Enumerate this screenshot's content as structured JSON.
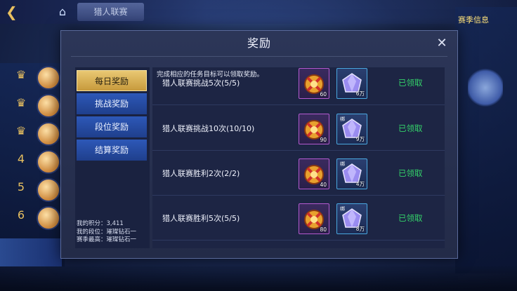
{
  "background": {
    "tab_label": "猎人联赛",
    "right_title": "赛季信息",
    "ranks": [
      "♛",
      "♛",
      "♛",
      "4",
      "5",
      "6"
    ]
  },
  "modal": {
    "title": "奖励",
    "close_icon": "close-icon",
    "hint": "完成相应的任务目标可以领取奖励。",
    "tabs": [
      {
        "label": "每日奖励",
        "active": true
      },
      {
        "label": "挑战奖励",
        "active": false
      },
      {
        "label": "段位奖励",
        "active": false
      },
      {
        "label": "结算奖励",
        "active": false
      }
    ],
    "stats": {
      "score": "我的积分：3,411",
      "rank": "我的段位：璀璨钻石一",
      "season_best": "赛季最高：璀璨钻石一"
    },
    "rows": [
      {
        "task": "猎人联赛挑战5次(5/5)",
        "reward1_qty": "60",
        "reward2_qty": "6万",
        "reward2_tag": "",
        "status": "已领取"
      },
      {
        "task": "猎人联赛挑战10次(10/10)",
        "reward1_qty": "90",
        "reward2_qty": "9万",
        "reward2_tag": "绑",
        "status": "已领取"
      },
      {
        "task": "猎人联赛胜利2次(2/2)",
        "reward1_qty": "40",
        "reward2_qty": "4万",
        "reward2_tag": "绑",
        "status": "已领取"
      },
      {
        "task": "猎人联赛胜利5次(5/5)",
        "reward1_qty": "80",
        "reward2_qty": "8万",
        "reward2_tag": "绑",
        "status": "已领取"
      }
    ],
    "colors": {
      "status_green": "#34d36a",
      "active_tab": "#e0b860",
      "tab_blue": "#2a52ad"
    }
  }
}
